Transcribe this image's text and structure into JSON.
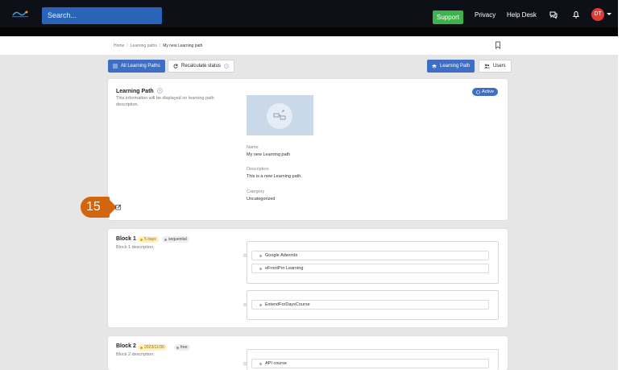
{
  "topbar": {
    "search_placeholder": "Search...",
    "support_label": "Support",
    "privacy_label": "Privacy",
    "helpdesk_label": "Help Desk",
    "avatar_initials": "DT"
  },
  "breadcrumb": {
    "home": "Home",
    "section": "Learning paths",
    "current": "My new Learning path"
  },
  "toolbar": {
    "all_paths_label": "All Learning Paths",
    "recalculate_label": "Recalculate status",
    "learning_path_label": "Learning Path",
    "users_label": "Users"
  },
  "info_card": {
    "title": "Learning Path",
    "description": "This information will be displayed on learning path description.",
    "status": "Active",
    "name_label": "Name",
    "name_value": "My new Learning path",
    "description_label": "Description",
    "description_value": "This is a new Learning path.",
    "category_label": "Category",
    "category_value": "Uncategorized",
    "step_number": "15"
  },
  "blocks": [
    {
      "title": "Block 1",
      "tag_yellow": "5 days",
      "tag_gray": "sequential",
      "description": "Block 1 description.",
      "group1": [
        "Google Adwords",
        "eFrontPro Learning"
      ],
      "group2": [
        "ExtendForDaysCourse"
      ]
    },
    {
      "title": "Block 2",
      "tag_yellow": "2023/11/30",
      "tag_gray": "free",
      "description": "Block 2 description.",
      "group1": [
        "API course"
      ]
    }
  ],
  "colors": {
    "topbar": "#0d1117",
    "search": "#2a64b8",
    "support": "#3fb24b",
    "primary": "#3f6fc4",
    "avatar": "#e53935",
    "step_badge": "#d3650d"
  }
}
